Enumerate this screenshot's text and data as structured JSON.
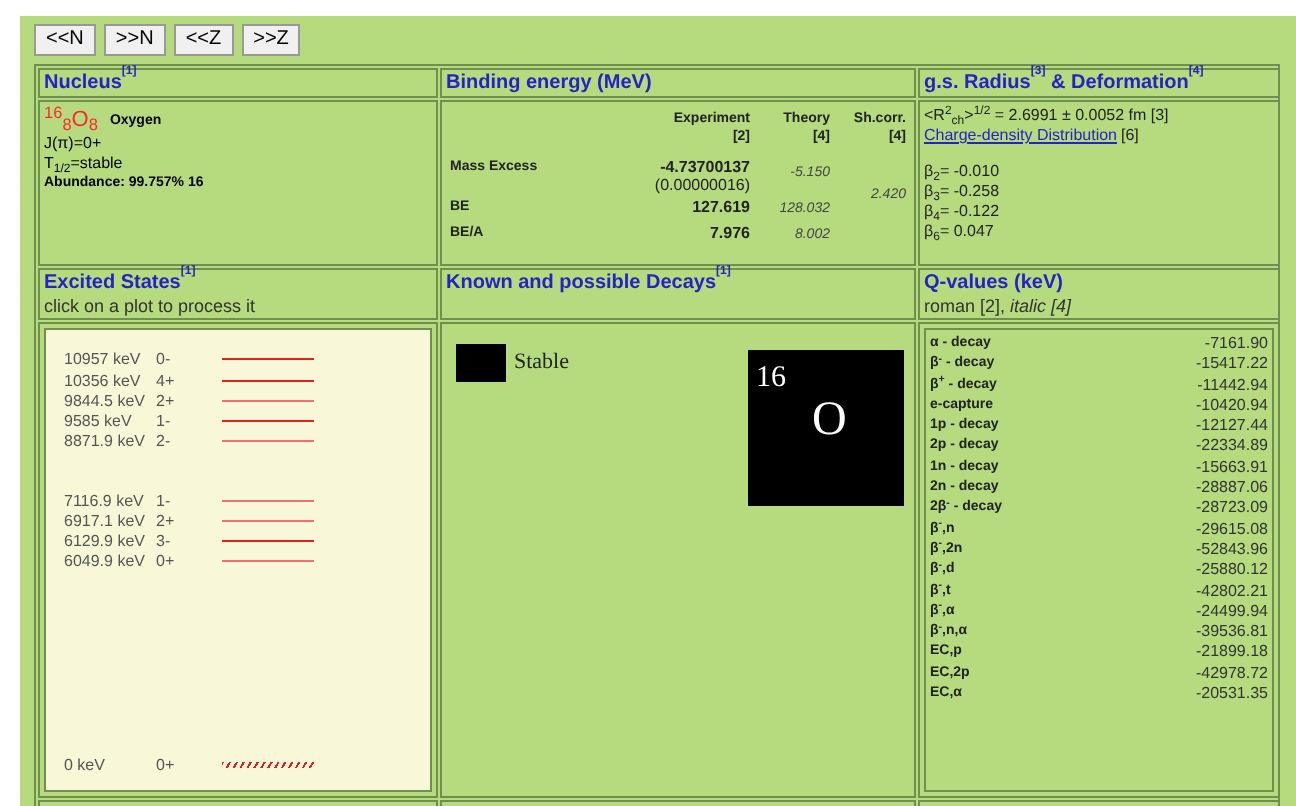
{
  "nav_buttons": [
    "<<N",
    ">>N",
    "<<Z",
    ">>Z"
  ],
  "nucleus": {
    "title": "Nucleus",
    "ref": "[1]",
    "symbol": "$^{16}$$_{8}$O$_{8}$",
    "name": "Oxygen",
    "spin": "J(π)=0+",
    "half_life_label": "T$_{1/2}$=stable",
    "abundance": "Abundance: 99.757% 16"
  },
  "binding": {
    "title": "Binding energy (MeV)",
    "columns": [
      {
        "label": "Experiment",
        "ref": "[2]"
      },
      {
        "label": "Theory",
        "ref": "[4]"
      },
      {
        "label": "Sh.corr.",
        "ref": "[4]"
      }
    ],
    "rows": [
      {
        "label": "Mass Excess",
        "experiment": "-4.73700137",
        "uncertainty": "(0.00000016)",
        "theory": "-5.150"
      },
      {
        "label": "BE",
        "experiment": "127.619",
        "theory": "128.032"
      },
      {
        "label": "BE/A",
        "experiment": "7.976",
        "theory": "8.002"
      }
    ],
    "shell_correction": "2.420"
  },
  "radius": {
    "title": "g.s. Radius$^{[3]}$ & Deformation$^{[4]}$",
    "radius_text": "<R$^{2}$$_{ch}$>$^{1/2}$ = 2.6991 ± 0.0052 fm [3]",
    "link": "Charge-density Distribution",
    "link_ref": "[6]",
    "betas": [
      "β$_{2}$= -0.010",
      "β$_{3}$= -0.258",
      "β$_{4}$= -0.122",
      "β$_{6}$= 0.047"
    ]
  },
  "excited": {
    "title": "Excited States",
    "ref": "[1]",
    "hint": "click on a plot to process it",
    "levels": [
      {
        "energy": "10957 keV",
        "spin": "0-",
        "kind": "excited",
        "color": "#e02020"
      },
      {
        "energy": "10356 keV",
        "spin": "4+",
        "kind": "excited",
        "color": "#e02020"
      },
      {
        "energy": "9844.5 keV",
        "spin": "2+",
        "kind": "excited",
        "color": "#f07070"
      },
      {
        "energy": "9585 keV",
        "spin": "1-",
        "kind": "excited",
        "color": "#e02020"
      },
      {
        "energy": "8871.9 keV",
        "spin": "2-",
        "kind": "excited",
        "color": "#f07070"
      },
      {
        "energy": "7116.9 keV",
        "spin": "1-",
        "kind": "excited",
        "color": "#f07070"
      },
      {
        "energy": "6917.1 keV",
        "spin": "2+",
        "kind": "excited",
        "color": "#f07070"
      },
      {
        "energy": "6129.9 keV",
        "spin": "3-",
        "kind": "excited",
        "color": "#e02020"
      },
      {
        "energy": "6049.9 keV",
        "spin": "0+",
        "kind": "excited",
        "color": "#f07070"
      },
      {
        "energy": "0 keV",
        "spin": "0+",
        "kind": "ground",
        "color": "#e02020"
      }
    ]
  },
  "decays": {
    "title": "Known and possible Decays",
    "ref": "[1]",
    "legend": [
      {
        "label": "Stable",
        "color": "#000000"
      }
    ],
    "tile": {
      "mass": "16",
      "symbol": "O",
      "color": "#000000"
    }
  },
  "qvalues": {
    "title": "Q-values (keV)",
    "legend": "roman [2], *italic [4]*",
    "rows": [
      {
        "label": "α - decay",
        "value": "-7161.90"
      },
      {
        "label": "β$^{-}$ - decay",
        "value": "-15417.22"
      },
      {
        "label": "β$^{+}$ - decay",
        "value": "-11442.94"
      },
      {
        "label": "e-capture",
        "value": "-10420.94"
      },
      {
        "label": "1p - decay",
        "value": "-12127.44"
      },
      {
        "label": "2p - decay",
        "value": "-22334.89"
      },
      {
        "label": "1n - decay",
        "value": "-15663.91"
      },
      {
        "label": "2n - decay",
        "value": "-28887.06"
      },
      {
        "label": "2β$^{-}$ - decay",
        "value": "-28723.09"
      },
      {
        "label": "β$^{-}$,n",
        "value": "-29615.08"
      },
      {
        "label": "β$^{-}$,2n",
        "value": "-52843.96"
      },
      {
        "label": "β$^{-}$,d",
        "value": "-25880.12"
      },
      {
        "label": "β$^{-}$,t",
        "value": "-42802.21"
      },
      {
        "label": "β$^{-}$,α",
        "value": "-24499.94"
      },
      {
        "label": "β$^{-}$,n,α",
        "value": "-39536.81"
      },
      {
        "label": "EC,p",
        "value": "-21899.18"
      },
      {
        "label": "EC,2p",
        "value": "-42978.72"
      },
      {
        "label": "EC,α",
        "value": "-20531.35"
      }
    ]
  }
}
